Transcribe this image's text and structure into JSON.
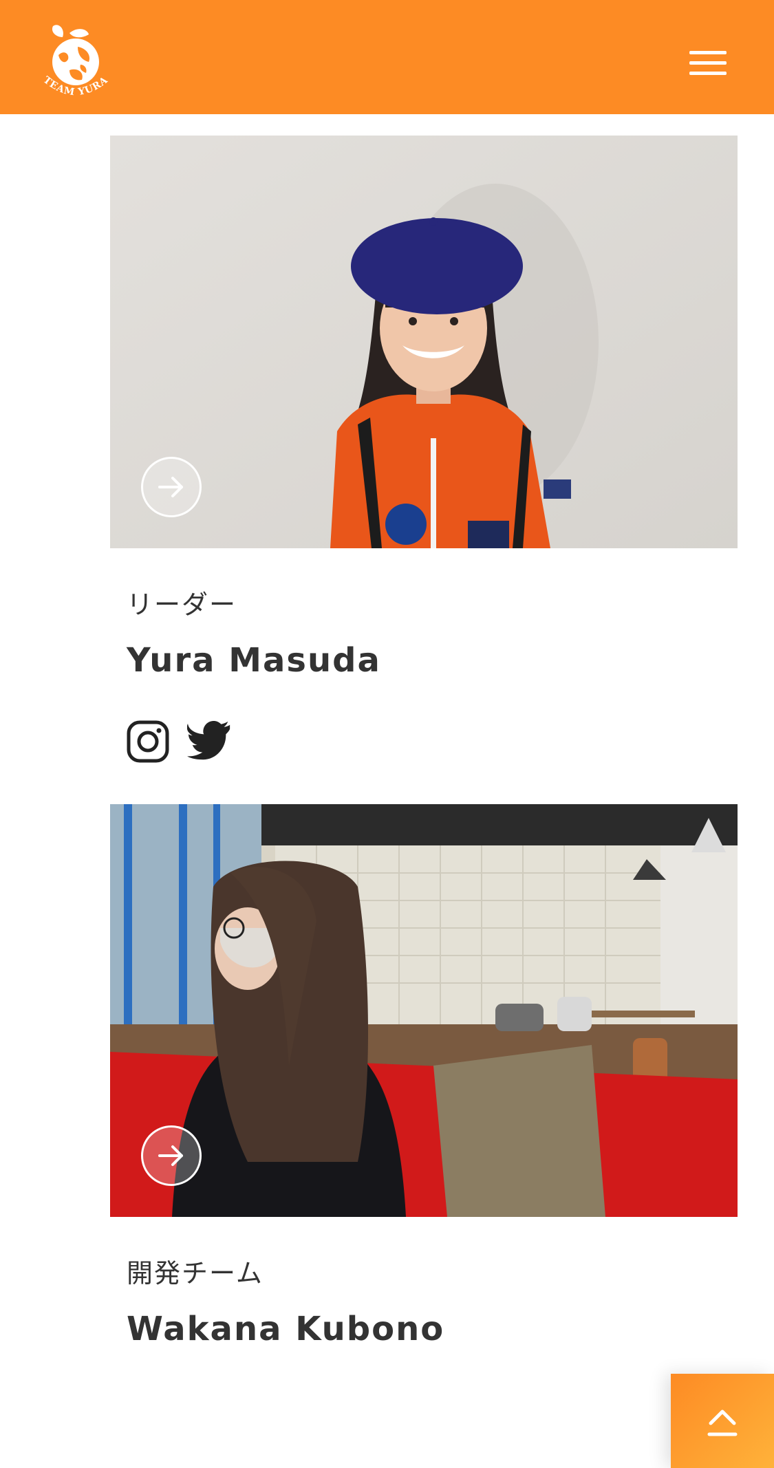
{
  "header": {
    "logo_text": "TEAM YURA",
    "menu_icon": "hamburger-menu-icon",
    "brand_color": "#fd8b24"
  },
  "members": [
    {
      "role": "リーダー",
      "name": "Yura Masuda",
      "photo_description": "photo of Yura Masuda",
      "social": [
        "instagram-icon",
        "twitter-icon"
      ]
    },
    {
      "role": "開発チーム",
      "name": "Wakana Kubono",
      "photo_description": "photo of Wakana Kubono",
      "social": []
    }
  ],
  "back_to_top_icon": "chevron-up-icon"
}
